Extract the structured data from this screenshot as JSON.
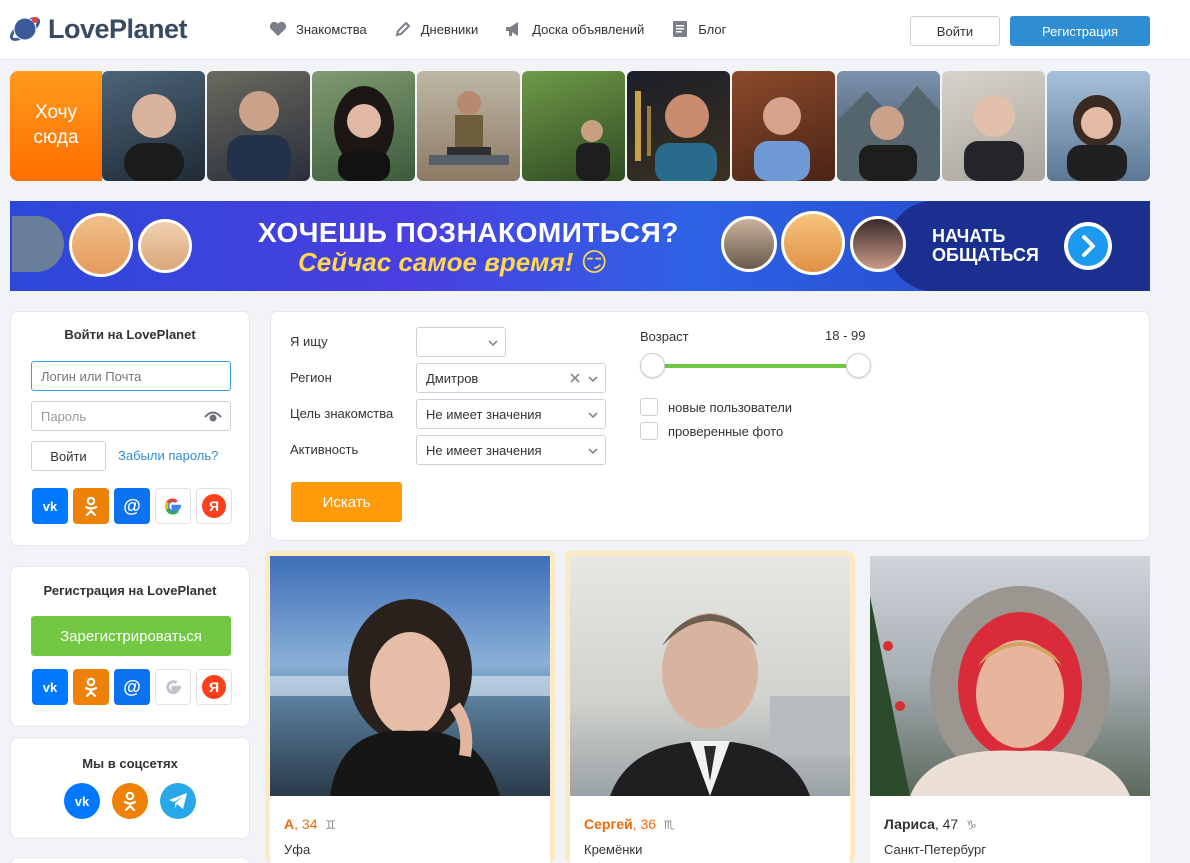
{
  "header": {
    "logo": "LovePlanet",
    "nav": [
      {
        "label": "Знакомства",
        "icon": "heart-icon"
      },
      {
        "label": "Дневники",
        "icon": "pencil-icon"
      },
      {
        "label": "Доска объявлений",
        "icon": "megaphone-icon"
      },
      {
        "label": "Блог",
        "icon": "document-icon"
      }
    ],
    "login_label": "Войти",
    "register_label": "Регистрация"
  },
  "strip": {
    "want_here": "Хочу\nсюда",
    "photos": [
      "#3b4f63",
      "#2d3a4a",
      "#5b7a5e",
      "#8c7a64",
      "#4d6b3a",
      "#2a2e3a",
      "#8a4a2e",
      "#5d6e85",
      "#b4aaa0",
      "#7e8fa3"
    ]
  },
  "banner": {
    "title": "ХОЧЕШЬ ПОЗНАКОМИТЬСЯ?",
    "subtitle": "Сейчас самое время! 😏",
    "cta_line1": "НАЧАТЬ",
    "cta_line2": "ОБЩАТЬСЯ"
  },
  "login_panel": {
    "title": "Войти на LovePlanet",
    "login_placeholder": "Логин или Почта",
    "password_placeholder": "Пароль",
    "login_button": "Войти",
    "forgot_link": "Забыли пароль?"
  },
  "register_panel": {
    "title": "Регистрация на LovePlanet",
    "register_button": "Зарегистрироваться"
  },
  "social_panel": {
    "title": "Мы в соцсетях"
  },
  "search": {
    "looking_for_label": "Я ищу",
    "looking_for_value": "",
    "region_label": "Регион",
    "region_value": "Дмитров",
    "goal_label": "Цель знакомства",
    "goal_value": "Не имеет значения",
    "activity_label": "Активность",
    "activity_value": "Не имеет значения",
    "search_button": "Искать",
    "age_label": "Возраст",
    "age_value": "18 - 99",
    "age_min": 18,
    "age_max": 99,
    "new_users_label": "новые пользователи",
    "new_users_checked": false,
    "verified_label": "проверенные фото",
    "verified_checked": false
  },
  "cards": [
    {
      "name": "А",
      "age": ", 34",
      "zodiac": "♊",
      "city": "Уфа",
      "highlight": true
    },
    {
      "name": "Сергей",
      "age": ", 36",
      "zodiac": "♏",
      "city": "Кремёнки",
      "highlight": true
    },
    {
      "name": "Лариса",
      "age": ", 47",
      "zodiac": "♑",
      "city": "Санкт-Петербург",
      "highlight": false
    }
  ],
  "colors": {
    "accent_blue": "#2f8ed3",
    "orange": "#ff9b0a",
    "green": "#72c843",
    "name_orange": "#ee6a0a"
  }
}
